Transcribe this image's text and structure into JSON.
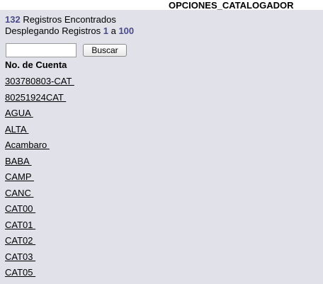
{
  "title": "OPCIONES_CATALOGADOR",
  "status": {
    "total": "132",
    "found_text": " Registros Encontrados",
    "showing_text": "Desplegando Registros ",
    "from": "1",
    "separator": " a ",
    "to": "100"
  },
  "search": {
    "value": "",
    "button_label": "Buscar"
  },
  "table": {
    "header": "No. de Cuenta",
    "records": [
      "303780803-CAT ",
      "80251924CAT ",
      "AGUA ",
      "ALTA ",
      "Acambaro ",
      "BABA ",
      "CAMP ",
      "CANC ",
      "CAT00 ",
      "CAT01 ",
      "CAT02 ",
      "CAT03 ",
      "CAT05 "
    ]
  }
}
